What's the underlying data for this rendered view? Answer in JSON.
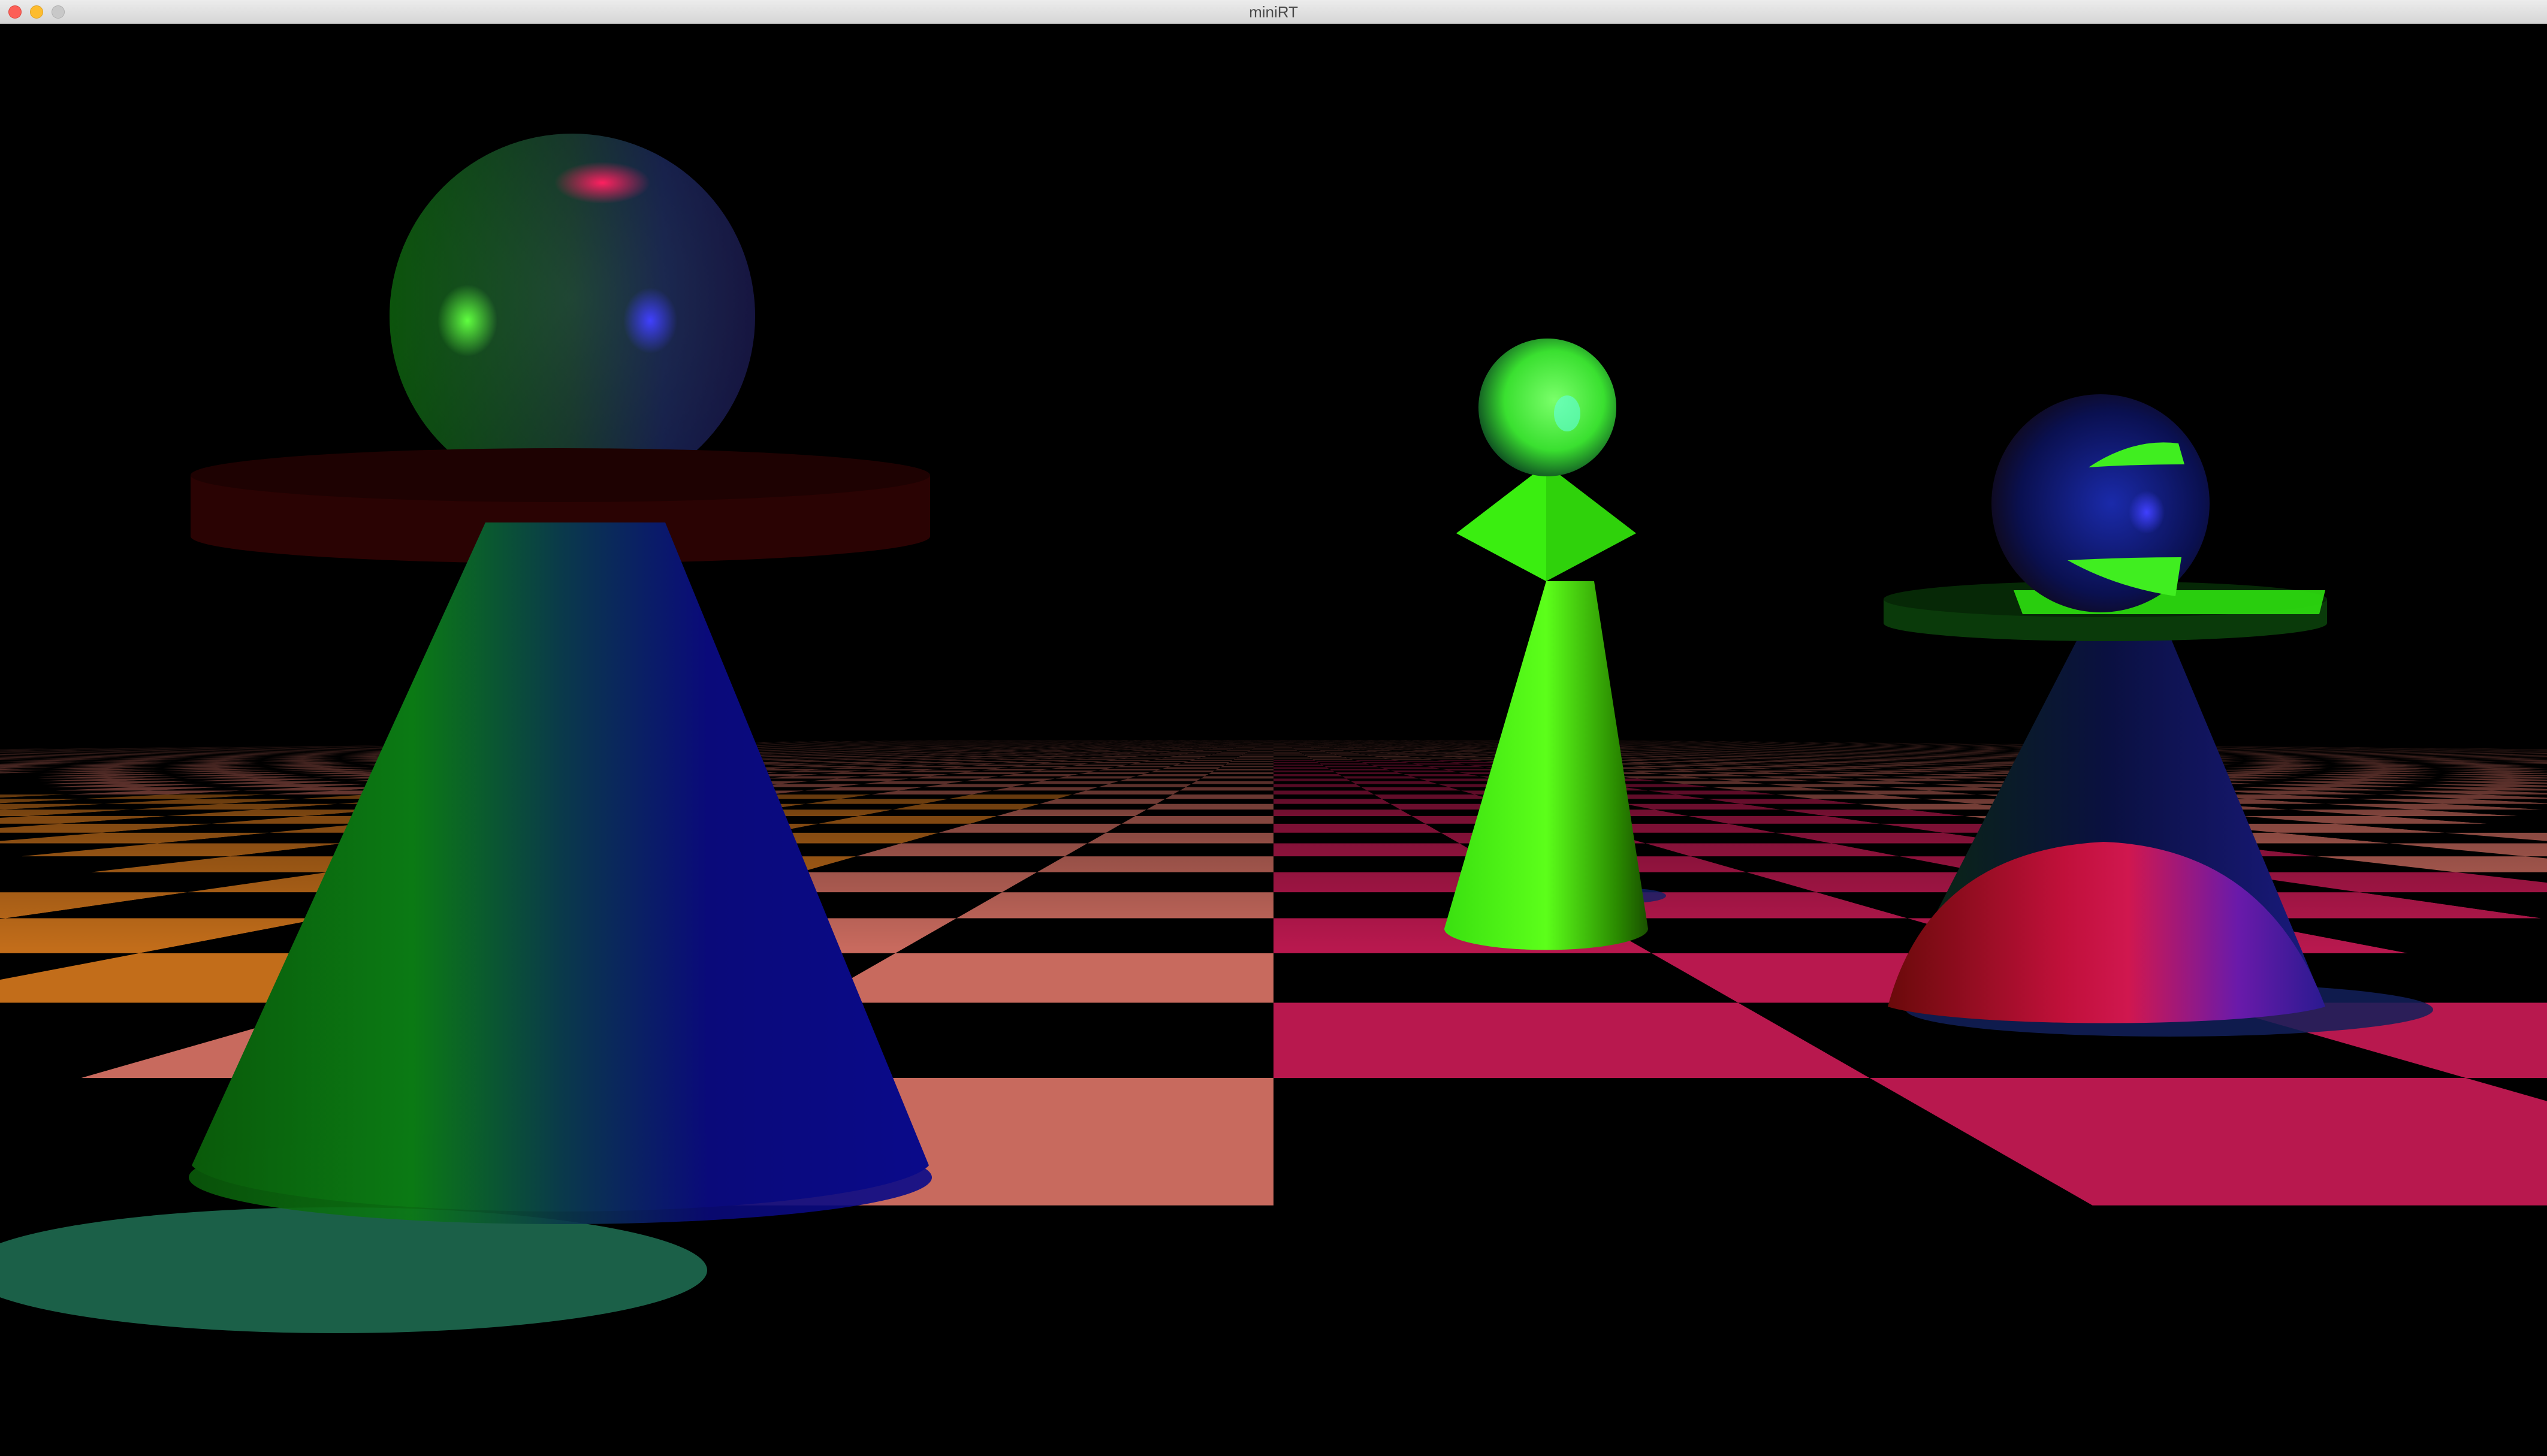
{
  "window": {
    "title": "miniRT",
    "controls": {
      "close": "close-button",
      "minimize": "minimize-button",
      "zoom": "zoom-button"
    }
  },
  "scene": {
    "background_color": "#000000",
    "floor": {
      "pattern": "checkerboard",
      "light_color": "#c86a5e",
      "pink_color": "#b8184e",
      "orange_color": "#c26d1a",
      "dark_color": "#000000"
    },
    "objects": [
      {
        "name": "large-pawn",
        "colors": [
          "#0a7a0a",
          "#04107a"
        ]
      },
      {
        "name": "green-pawn",
        "colors": [
          "#4dff10",
          "#2aa000"
        ]
      },
      {
        "name": "blue-pawn",
        "colors": [
          "#0a1050",
          "#1a2aaa",
          "#d0174f"
        ]
      }
    ]
  }
}
